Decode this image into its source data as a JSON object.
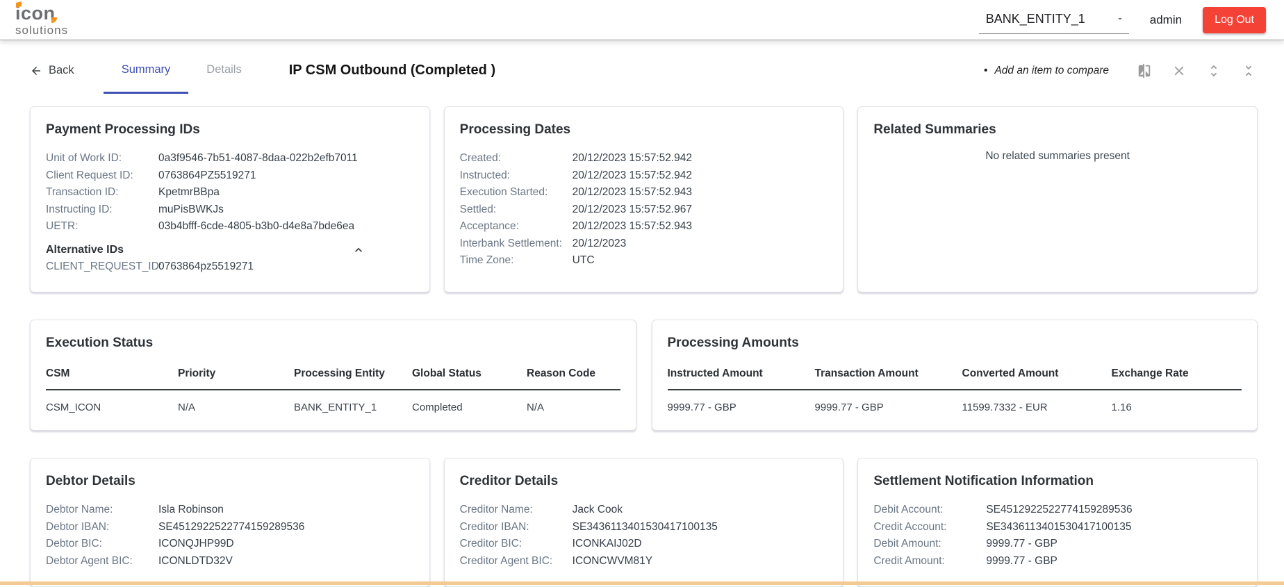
{
  "header": {
    "logo_line1": "icon",
    "logo_line2": "solutions",
    "entity": "BANK_ENTITY_1",
    "user": "admin",
    "logout_label": "Log Out"
  },
  "toolbar": {
    "back_label": "Back",
    "tab_summary": "Summary",
    "tab_details": "Details",
    "title": "IP CSM Outbound (Completed )",
    "compare_bullet": "•",
    "compare_hint": "Add an item to compare"
  },
  "cards": {
    "payment_ids": {
      "title": "Payment Processing IDs",
      "fields": [
        {
          "label": "Unit of Work ID:",
          "value": "0a3f9546-7b51-4087-8daa-022b2efb7011"
        },
        {
          "label": "Client Request ID:",
          "value": "0763864PZ5519271"
        },
        {
          "label": "Transaction ID:",
          "value": "KpetmrBBpa"
        },
        {
          "label": "Instructing ID:",
          "value": "muPisBWKJs"
        },
        {
          "label": "UETR:",
          "value": "03b4bfff-6cde-4805-b3b0-d4e8a7bde6ea"
        }
      ],
      "alt_title": "Alternative IDs",
      "alt_fields": [
        {
          "label": "CLIENT_REQUEST_ID:",
          "value": "0763864pz5519271"
        }
      ]
    },
    "processing_dates": {
      "title": "Processing Dates",
      "fields": [
        {
          "label": "Created:",
          "value": "20/12/2023 15:57:52.942"
        },
        {
          "label": "Instructed:",
          "value": "20/12/2023 15:57:52.942"
        },
        {
          "label": "Execution Started:",
          "value": "20/12/2023 15:57:52.943"
        },
        {
          "label": "Settled:",
          "value": "20/12/2023 15:57:52.967"
        },
        {
          "label": "Acceptance:",
          "value": "20/12/2023 15:57:52.943"
        },
        {
          "label": "Interbank Settlement:",
          "value": "20/12/2023"
        },
        {
          "label": "Time Zone:",
          "value": "UTC"
        }
      ]
    },
    "related_summaries": {
      "title": "Related Summaries",
      "empty_text": "No related summaries present"
    },
    "execution_status": {
      "title": "Execution Status",
      "columns": [
        "CSM",
        "Priority",
        "Processing Entity",
        "Global Status",
        "Reason Code"
      ],
      "rows": [
        [
          "CSM_ICON",
          "N/A",
          "BANK_ENTITY_1",
          "Completed",
          "N/A"
        ]
      ]
    },
    "processing_amounts": {
      "title": "Processing Amounts",
      "columns": [
        "Instructed Amount",
        "Transaction Amount",
        "Converted Amount",
        "Exchange Rate"
      ],
      "rows": [
        [
          "9999.77 - GBP",
          "9999.77 - GBP",
          "11599.7332 - EUR",
          "1.16"
        ]
      ]
    },
    "debtor": {
      "title": "Debtor Details",
      "fields": [
        {
          "label": "Debtor Name:",
          "value": "Isla Robinson"
        },
        {
          "label": "Debtor IBAN:",
          "value": "SE4512922522774159289536"
        },
        {
          "label": "Debtor BIC:",
          "value": "ICONQJHP99D"
        },
        {
          "label": "Debtor Agent BIC:",
          "value": "ICONLDTD32V"
        }
      ]
    },
    "creditor": {
      "title": "Creditor Details",
      "fields": [
        {
          "label": "Creditor Name:",
          "value": "Jack Cook"
        },
        {
          "label": "Creditor IBAN:",
          "value": "SE3436113401530417100135"
        },
        {
          "label": "Creditor BIC:",
          "value": "ICONKAIJ02D"
        },
        {
          "label": "Creditor Agent BIC:",
          "value": "ICONCWVM81Y"
        }
      ]
    },
    "settlement": {
      "title": "Settlement Notification Information",
      "fields": [
        {
          "label": "Debit Account:",
          "value": "SE4512922522774159289536"
        },
        {
          "label": "Credit Account:",
          "value": "SE3436113401530417100135"
        },
        {
          "label": "Debit Amount:",
          "value": "9999.77 - GBP"
        },
        {
          "label": "Credit Amount:",
          "value": "9999.77 - GBP"
        }
      ]
    }
  },
  "colors": {
    "accent_red": "#f44336",
    "active_tab_blue": "#3f51b5",
    "label_gray_blue": "#6b7786",
    "icon_gray": "#9b9b9b",
    "logo_gray": "#6d6e71",
    "logo_orange": "#f7941d",
    "footer_orange": "#f4ca94"
  }
}
